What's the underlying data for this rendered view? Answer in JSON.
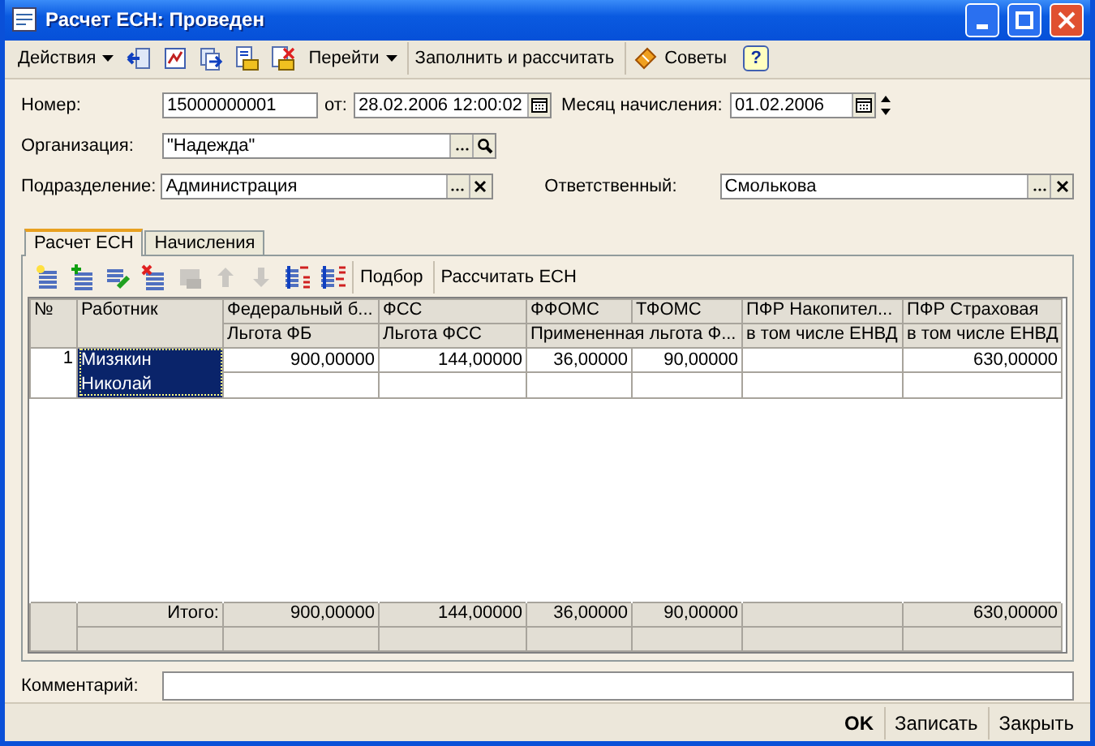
{
  "window": {
    "title": "Расчет ЕСН: Проведен"
  },
  "toolbar": [
    {
      "kind": "menu",
      "label": "Действия"
    },
    {
      "kind": "icon",
      "disabled": false
    },
    {
      "kind": "icon",
      "disabled": false
    },
    {
      "kind": "icon",
      "disabled": false
    },
    {
      "kind": "icon",
      "disabled": false
    },
    {
      "kind": "icon",
      "disabled": false
    },
    {
      "kind": "menu",
      "label": "Перейти"
    },
    {
      "kind": "button",
      "label": "Заполнить и рассчитать"
    },
    {
      "kind": "tip",
      "label": "Советы"
    },
    {
      "kind": "help",
      "label": "?"
    }
  ],
  "form": {
    "number_label": "Номер:",
    "number": "15000000001",
    "date_label": "от:",
    "date": "28.02.2006 12:00:02",
    "month_label": "Месяц начисления:",
    "month": "01.02.2006",
    "organization_label": "Организация:",
    "organization": "\"Надежда\"",
    "department_label": "Подразделение:",
    "department": "Администрация",
    "responsible_label": "Ответственный:",
    "responsible": "Смолькова"
  },
  "tabs": [
    {
      "label": "Расчет ЕСН",
      "selected": true
    },
    {
      "label": "Начисления",
      "selected": false
    }
  ],
  "table_toolbar": [
    {
      "kind": "icon",
      "disabled": false
    },
    {
      "kind": "icon",
      "disabled": false
    },
    {
      "kind": "icon",
      "disabled": false
    },
    {
      "kind": "icon",
      "disabled": false
    },
    {
      "kind": "icon",
      "disabled": true
    },
    {
      "kind": "icon",
      "disabled": true
    },
    {
      "kind": "icon",
      "disabled": true
    },
    {
      "kind": "icon",
      "disabled": false
    },
    {
      "kind": "icon",
      "disabled": false
    },
    {
      "kind": "button",
      "label": "Подбор"
    },
    {
      "kind": "button",
      "label": "Рассчитать ЕСН"
    }
  ],
  "table": {
    "columns": [
      {
        "label": "№"
      },
      {
        "label": "Работник"
      },
      {
        "label": "Федеральный б...",
        "sub": "Льгота ФБ"
      },
      {
        "label": "ФСС",
        "sub": "Льгота ФСС"
      },
      {
        "label": "ФФОМС",
        "sub": "Примененная льгота Ф..."
      },
      {
        "label": "ТФОМС"
      },
      {
        "label": "ПФР Накопител...",
        "sub": "в том числе ЕНВД"
      },
      {
        "label": "ПФР Страховая",
        "sub": "в том числе ЕНВД"
      }
    ],
    "rows": [
      {
        "selected": true,
        "cells": [
          "1",
          "Мизякин Николай",
          "900,00000",
          "144,00000",
          "36,00000",
          "90,00000",
          "",
          "630,00000"
        ]
      }
    ],
    "totals": {
      "cells": [
        "",
        "Итого:",
        "900,00000",
        "144,00000",
        "36,00000",
        "90,00000",
        "",
        "630,00000"
      ]
    }
  },
  "comment": {
    "label": "Комментарий:"
  },
  "buttons": [
    {
      "label": "OK",
      "default": true
    },
    {
      "label": "Записать",
      "default": false
    },
    {
      "label": "Закрыть",
      "default": false
    }
  ]
}
